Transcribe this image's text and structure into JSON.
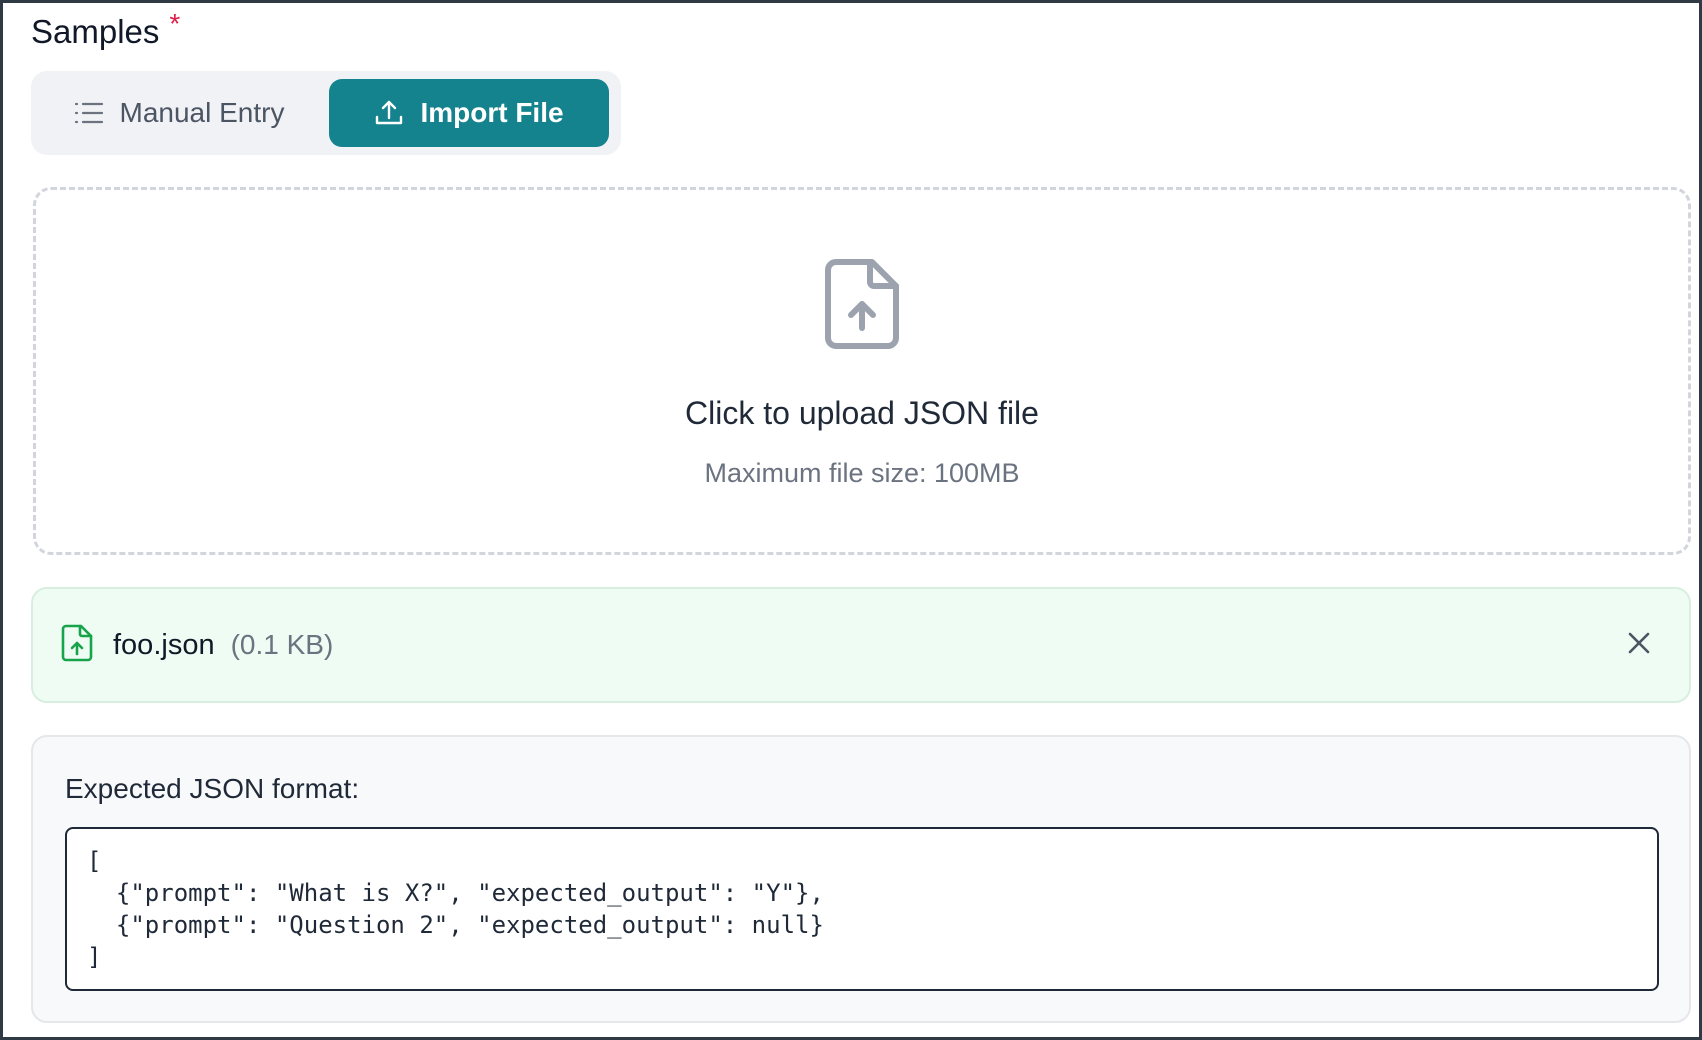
{
  "section": {
    "title": "Samples",
    "required_marker": "*"
  },
  "tabs": {
    "manual": {
      "label": "Manual Entry",
      "icon": "list-icon",
      "active": false
    },
    "import": {
      "label": "Import File",
      "icon": "upload-icon",
      "active": true
    }
  },
  "dropzone": {
    "icon": "file-upload-icon",
    "title": "Click to upload JSON file",
    "subtitle": "Maximum file size: 100MB"
  },
  "selected_file": {
    "icon": "file-upload-icon",
    "name": "foo.json",
    "size": "(0.1 KB)",
    "remove_icon": "close-icon"
  },
  "format": {
    "label": "Expected JSON format:",
    "code_lines": [
      "[",
      "  {\"prompt\": \"What is X?\", \"expected_output\": \"Y\"},",
      "  {\"prompt\": \"Question 2\", \"expected_output\": null}",
      "]"
    ]
  },
  "colors": {
    "accent": "#14838d",
    "required": "#e11d48",
    "success_bg": "#effcf3",
    "success_icon": "#16a34a"
  }
}
